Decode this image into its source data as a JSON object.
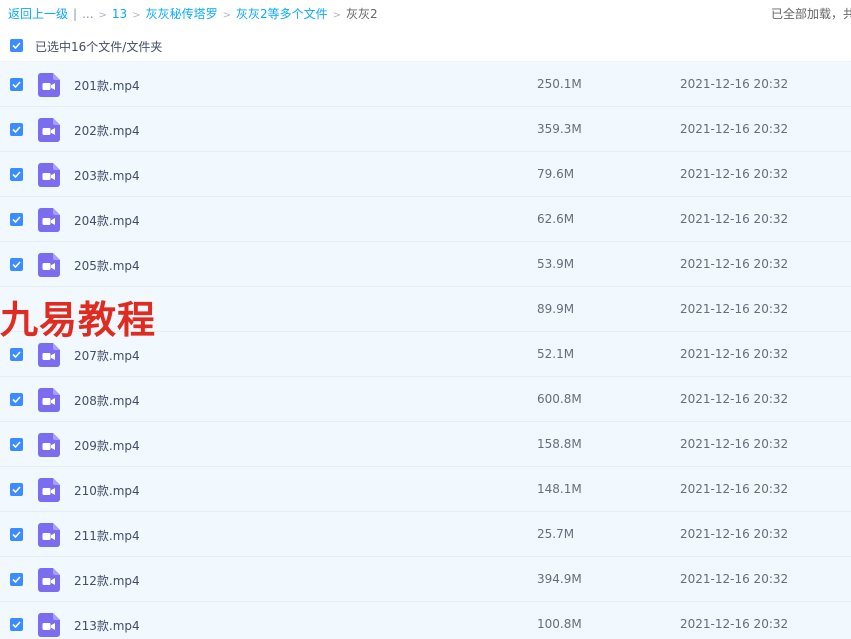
{
  "breadcrumb": {
    "back": "返回上一级",
    "ellipsis": "...",
    "items": [
      "13",
      "灰灰秘传塔罗",
      "灰灰2等多个文件"
    ],
    "current": "灰灰2"
  },
  "status": {
    "loaded": "已全部加载，共"
  },
  "selection": {
    "label": "已选中16个文件/文件夹",
    "checked": true
  },
  "colors": {
    "accent": "#09aaff",
    "checkbox": "#3b8cff",
    "video_icon": "#7b6cf0",
    "watermark": "#e02b20",
    "row_bg": "#f1f8fe"
  },
  "watermark": "九易教程",
  "files": [
    {
      "name": "201款.mp4",
      "size": "250.1M",
      "date": "2021-12-16 20:32",
      "checked": true,
      "icon": "video-file-icon"
    },
    {
      "name": "202款.mp4",
      "size": "359.3M",
      "date": "2021-12-16 20:32",
      "checked": true,
      "icon": "video-file-icon"
    },
    {
      "name": "203款.mp4",
      "size": "79.6M",
      "date": "2021-12-16 20:32",
      "checked": true,
      "icon": "video-file-icon"
    },
    {
      "name": "204款.mp4",
      "size": "62.6M",
      "date": "2021-12-16 20:32",
      "checked": true,
      "icon": "video-file-icon"
    },
    {
      "name": "205款.mp4",
      "size": "53.9M",
      "date": "2021-12-16 20:32",
      "checked": true,
      "icon": "video-file-icon"
    },
    {
      "name": "",
      "size": "89.9M",
      "date": "2021-12-16 20:32",
      "checked": false,
      "icon": ""
    },
    {
      "name": "207款.mp4",
      "size": "52.1M",
      "date": "2021-12-16 20:32",
      "checked": true,
      "icon": "video-file-icon"
    },
    {
      "name": "208款.mp4",
      "size": "600.8M",
      "date": "2021-12-16 20:32",
      "checked": true,
      "icon": "video-file-icon"
    },
    {
      "name": "209款.mp4",
      "size": "158.8M",
      "date": "2021-12-16 20:32",
      "checked": true,
      "icon": "video-file-icon"
    },
    {
      "name": "210款.mp4",
      "size": "148.1M",
      "date": "2021-12-16 20:32",
      "checked": true,
      "icon": "video-file-icon"
    },
    {
      "name": "211款.mp4",
      "size": "25.7M",
      "date": "2021-12-16 20:32",
      "checked": true,
      "icon": "video-file-icon"
    },
    {
      "name": "212款.mp4",
      "size": "394.9M",
      "date": "2021-12-16 20:32",
      "checked": true,
      "icon": "video-file-icon"
    },
    {
      "name": "213款.mp4",
      "size": "100.8M",
      "date": "2021-12-16 20:32",
      "checked": true,
      "icon": "video-file-icon"
    }
  ]
}
